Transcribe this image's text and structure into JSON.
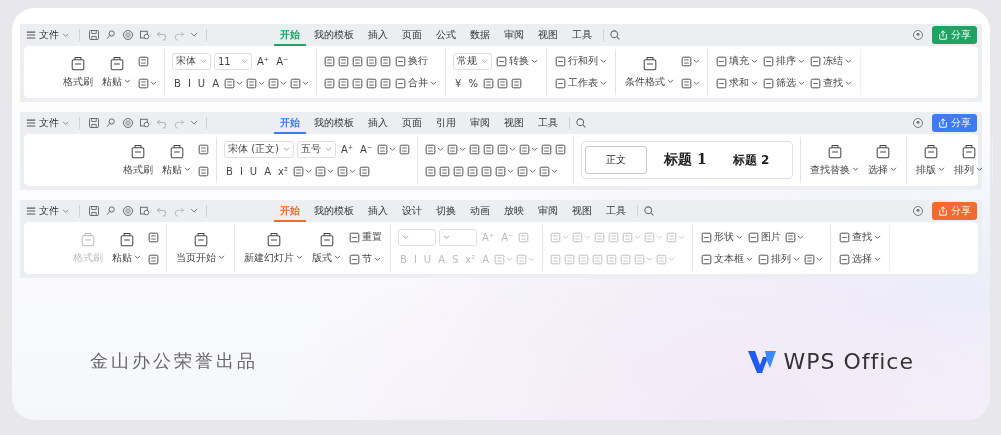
{
  "toolbars": [
    {
      "kind": "spreadsheet",
      "color": "#1ea362",
      "file_menu": "文件",
      "share": "分享",
      "tabs": [
        {
          "label": "开始",
          "selected": true
        },
        {
          "label": "我的模板",
          "selected": false
        },
        {
          "label": "插入",
          "selected": false
        },
        {
          "label": "页面",
          "selected": false
        },
        {
          "label": "公式",
          "selected": false
        },
        {
          "label": "数据",
          "selected": false
        },
        {
          "label": "审阅",
          "selected": false
        },
        {
          "label": "视图",
          "selected": false
        },
        {
          "label": "工具",
          "selected": false
        }
      ],
      "groups": [
        {
          "disabled": false,
          "items": [
            {
              "kind": "large",
              "label": "格式刷",
              "caret": false,
              "disabled": false
            },
            {
              "kind": "large",
              "label": "粘贴",
              "caret": true,
              "disabled": false
            },
            {
              "kind": "stack",
              "top": [
                {
                  "kind": "icon",
                  "caret": false
                }
              ],
              "bottom": [
                {
                  "kind": "icon",
                  "caret": true
                }
              ]
            }
          ]
        },
        {
          "disabled": false,
          "items": [
            {
              "kind": "stack",
              "top": [
                {
                  "kind": "field",
                  "value": "宋体"
                },
                {
                  "kind": "field",
                  "value": "11"
                },
                {
                  "kind": "glyph",
                  "text": "A⁺"
                },
                {
                  "kind": "glyph",
                  "text": "A⁻"
                }
              ],
              "bottom": [
                {
                  "kind": "glyph",
                  "text": "B"
                },
                {
                  "kind": "glyph",
                  "text": "I"
                },
                {
                  "kind": "glyph",
                  "text": "U"
                },
                {
                  "kind": "glyph",
                  "text": "A"
                },
                {
                  "kind": "icon",
                  "caret": true
                },
                {
                  "kind": "icon",
                  "caret": true
                },
                {
                  "kind": "icon",
                  "caret": true
                },
                {
                  "kind": "icon",
                  "caret": true
                }
              ]
            }
          ]
        },
        {
          "disabled": false,
          "items": [
            {
              "kind": "stack",
              "top": [
                {
                  "kind": "icon",
                  "caret": false
                },
                {
                  "kind": "icon",
                  "caret": false
                },
                {
                  "kind": "icon",
                  "caret": false
                },
                {
                  "kind": "icon",
                  "caret": false
                },
                {
                  "kind": "icon",
                  "caret": false
                },
                {
                  "kind": "labeled",
                  "label": "换行",
                  "caret": false
                }
              ],
              "bottom": [
                {
                  "kind": "icon",
                  "caret": false
                },
                {
                  "kind": "icon",
                  "caret": false
                },
                {
                  "kind": "icon",
                  "caret": false
                },
                {
                  "kind": "icon",
                  "caret": false
                },
                {
                  "kind": "icon",
                  "caret": false
                },
                {
                  "kind": "labeled",
                  "label": "合并",
                  "caret": true
                }
              ]
            }
          ]
        },
        {
          "disabled": false,
          "items": [
            {
              "kind": "stack",
              "top": [
                {
                  "kind": "field",
                  "value": "常规"
                },
                {
                  "kind": "labeled",
                  "label": "转换",
                  "caret": true
                }
              ],
              "bottom": [
                {
                  "kind": "glyph",
                  "text": "¥"
                },
                {
                  "kind": "glyph",
                  "text": "%"
                },
                {
                  "kind": "icon",
                  "caret": false
                },
                {
                  "kind": "icon",
                  "caret": false
                },
                {
                  "kind": "icon",
                  "caret": false
                }
              ]
            }
          ]
        },
        {
          "disabled": false,
          "items": [
            {
              "kind": "stack",
              "top": [
                {
                  "kind": "labeled",
                  "label": "行和列",
                  "caret": true
                }
              ],
              "bottom": [
                {
                  "kind": "labeled",
                  "label": "工作表",
                  "caret": true
                }
              ]
            }
          ]
        },
        {
          "disabled": false,
          "items": [
            {
              "kind": "large",
              "label": "条件格式",
              "caret": true,
              "disabled": false
            },
            {
              "kind": "stack",
              "top": [
                {
                  "kind": "icon",
                  "caret": true
                }
              ],
              "bottom": [
                {
                  "kind": "icon",
                  "caret": true
                }
              ]
            }
          ]
        },
        {
          "disabled": false,
          "items": [
            {
              "kind": "stack",
              "top": [
                {
                  "kind": "labeled",
                  "label": "填充",
                  "caret": true
                },
                {
                  "kind": "labeled",
                  "label": "排序",
                  "caret": true
                },
                {
                  "kind": "labeled",
                  "label": "冻结",
                  "caret": true
                }
              ],
              "bottom": [
                {
                  "kind": "labeled",
                  "label": "求和",
                  "caret": true
                },
                {
                  "kind": "labeled",
                  "label": "筛选",
                  "caret": true
                },
                {
                  "kind": "labeled",
                  "label": "查找",
                  "caret": true
                }
              ]
            }
          ]
        }
      ]
    },
    {
      "kind": "document",
      "color": "#3b7cf5",
      "file_menu": "文件",
      "share": "分享",
      "tabs": [
        {
          "label": "开始",
          "selected": true
        },
        {
          "label": "我的模板",
          "selected": false
        },
        {
          "label": "插入",
          "selected": false
        },
        {
          "label": "页面",
          "selected": false
        },
        {
          "label": "引用",
          "selected": false
        },
        {
          "label": "审阅",
          "selected": false
        },
        {
          "label": "视图",
          "selected": false
        },
        {
          "label": "工具",
          "selected": false
        }
      ],
      "groups": [
        {
          "disabled": false,
          "items": [
            {
              "kind": "large",
              "label": "格式刷",
              "caret": false,
              "disabled": false
            },
            {
              "kind": "large",
              "label": "粘贴",
              "caret": true,
              "disabled": false
            },
            {
              "kind": "stack",
              "top": [
                {
                  "kind": "icon",
                  "caret": false
                }
              ],
              "bottom": [
                {
                  "kind": "icon",
                  "caret": false
                }
              ]
            }
          ]
        },
        {
          "disabled": false,
          "items": [
            {
              "kind": "stack",
              "top": [
                {
                  "kind": "field",
                  "value": "宋体 (正文)"
                },
                {
                  "kind": "field",
                  "value": "五号"
                },
                {
                  "kind": "glyph",
                  "text": "A⁺"
                },
                {
                  "kind": "glyph",
                  "text": "A⁻"
                },
                {
                  "kind": "icon",
                  "caret": true
                },
                {
                  "kind": "icon",
                  "caret": false
                }
              ],
              "bottom": [
                {
                  "kind": "glyph",
                  "text": "B"
                },
                {
                  "kind": "glyph",
                  "text": "I"
                },
                {
                  "kind": "glyph",
                  "text": "U"
                },
                {
                  "kind": "glyph",
                  "text": "A"
                },
                {
                  "kind": "glyph",
                  "text": "x²"
                },
                {
                  "kind": "icon",
                  "caret": true
                },
                {
                  "kind": "icon",
                  "caret": true
                },
                {
                  "kind": "icon",
                  "caret": true
                },
                {
                  "kind": "icon",
                  "caret": false
                }
              ]
            }
          ]
        },
        {
          "disabled": false,
          "items": [
            {
              "kind": "stack",
              "top": [
                {
                  "kind": "icon",
                  "caret": true
                },
                {
                  "kind": "icon",
                  "caret": true
                },
                {
                  "kind": "icon",
                  "caret": false
                },
                {
                  "kind": "icon",
                  "caret": false
                },
                {
                  "kind": "icon",
                  "caret": true
                },
                {
                  "kind": "icon",
                  "caret": true
                },
                {
                  "kind": "icon",
                  "caret": false
                },
                {
                  "kind": "icon",
                  "caret": false
                }
              ],
              "bottom": [
                {
                  "kind": "icon",
                  "caret": false
                },
                {
                  "kind": "icon",
                  "caret": false
                },
                {
                  "kind": "icon",
                  "caret": false
                },
                {
                  "kind": "icon",
                  "caret": false
                },
                {
                  "kind": "icon",
                  "caret": false
                },
                {
                  "kind": "icon",
                  "caret": true
                },
                {
                  "kind": "icon",
                  "caret": true
                },
                {
                  "kind": "icon",
                  "caret": true
                }
              ]
            }
          ]
        },
        {
          "disabled": false,
          "items": [
            {
              "kind": "gallery",
              "styles": [
                {
                  "label": "正文",
                  "selected": true
                },
                {
                  "label": "标题 1",
                  "selected": false
                },
                {
                  "label": "标题 2",
                  "selected": false
                }
              ]
            }
          ]
        },
        {
          "disabled": false,
          "items": [
            {
              "kind": "large",
              "label": "查找替换",
              "caret": true,
              "disabled": false
            },
            {
              "kind": "large",
              "label": "选择",
              "caret": true,
              "disabled": false
            }
          ]
        },
        {
          "disabled": false,
          "items": [
            {
              "kind": "large",
              "label": "排版",
              "caret": true,
              "disabled": false
            },
            {
              "kind": "large",
              "label": "排列",
              "caret": true,
              "disabled": false
            }
          ]
        }
      ]
    },
    {
      "kind": "presentation",
      "color": "#f26a2e",
      "file_menu": "文件",
      "share": "分享",
      "tabs": [
        {
          "label": "开始",
          "selected": true
        },
        {
          "label": "我的模板",
          "selected": false
        },
        {
          "label": "插入",
          "selected": false
        },
        {
          "label": "设计",
          "selected": false
        },
        {
          "label": "切换",
          "selected": false
        },
        {
          "label": "动画",
          "selected": false
        },
        {
          "label": "放映",
          "selected": false
        },
        {
          "label": "审阅",
          "selected": false
        },
        {
          "label": "视图",
          "selected": false
        },
        {
          "label": "工具",
          "selected": false
        }
      ],
      "groups": [
        {
          "disabled": false,
          "items": [
            {
              "kind": "large",
              "label": "格式刷",
              "caret": false,
              "disabled": true
            },
            {
              "kind": "large",
              "label": "粘贴",
              "caret": true,
              "disabled": false
            },
            {
              "kind": "stack",
              "top": [
                {
                  "kind": "icon",
                  "caret": false
                }
              ],
              "bottom": [
                {
                  "kind": "icon",
                  "caret": false
                }
              ]
            }
          ]
        },
        {
          "disabled": false,
          "items": [
            {
              "kind": "large",
              "label": "当页开始",
              "caret": true,
              "disabled": false
            }
          ]
        },
        {
          "disabled": false,
          "items": [
            {
              "kind": "large",
              "label": "新建幻灯片",
              "caret": true,
              "disabled": false
            },
            {
              "kind": "large",
              "label": "版式",
              "caret": true,
              "disabled": false
            },
            {
              "kind": "stack",
              "top": [
                {
                  "kind": "labeled",
                  "label": "重置",
                  "caret": false
                }
              ],
              "bottom": [
                {
                  "kind": "labeled",
                  "label": "节",
                  "caret": true
                }
              ]
            }
          ]
        },
        {
          "disabled": true,
          "items": [
            {
              "kind": "stack",
              "top": [
                {
                  "kind": "field"
                },
                {
                  "kind": "field"
                },
                {
                  "kind": "glyph",
                  "text": "A⁺"
                },
                {
                  "kind": "glyph",
                  "text": "A⁻"
                },
                {
                  "kind": "icon",
                  "caret": false
                }
              ],
              "bottom": [
                {
                  "kind": "glyph",
                  "text": "B"
                },
                {
                  "kind": "glyph",
                  "text": "I"
                },
                {
                  "kind": "glyph",
                  "text": "U"
                },
                {
                  "kind": "glyph",
                  "text": "A"
                },
                {
                  "kind": "glyph",
                  "text": "S"
                },
                {
                  "kind": "glyph",
                  "text": "x²"
                },
                {
                  "kind": "glyph",
                  "text": "A"
                },
                {
                  "kind": "icon",
                  "caret": true
                },
                {
                  "kind": "icon",
                  "caret": true
                }
              ]
            }
          ]
        },
        {
          "disabled": true,
          "items": [
            {
              "kind": "stack",
              "top": [
                {
                  "kind": "icon",
                  "caret": true
                },
                {
                  "kind": "icon",
                  "caret": true
                },
                {
                  "kind": "icon",
                  "caret": false
                },
                {
                  "kind": "icon",
                  "caret": false
                },
                {
                  "kind": "icon",
                  "caret": true
                },
                {
                  "kind": "icon",
                  "caret": true
                },
                {
                  "kind": "icon",
                  "caret": true
                }
              ],
              "bottom": [
                {
                  "kind": "icon",
                  "caret": false
                },
                {
                  "kind": "icon",
                  "caret": false
                },
                {
                  "kind": "icon",
                  "caret": false
                },
                {
                  "kind": "icon",
                  "caret": false
                },
                {
                  "kind": "icon",
                  "caret": false
                },
                {
                  "kind": "icon",
                  "caret": false
                },
                {
                  "kind": "icon",
                  "caret": true
                },
                {
                  "kind": "icon",
                  "caret": true
                }
              ]
            }
          ]
        },
        {
          "disabled": false,
          "items": [
            {
              "kind": "stack",
              "top": [
                {
                  "kind": "labeled",
                  "label": "形状",
                  "caret": true
                },
                {
                  "kind": "labeled",
                  "label": "图片",
                  "caret": false
                },
                {
                  "kind": "icon",
                  "caret": true
                }
              ],
              "bottom": [
                {
                  "kind": "labeled",
                  "label": "文本框",
                  "caret": true
                },
                {
                  "kind": "labeled",
                  "label": "排列",
                  "caret": true
                },
                {
                  "kind": "icon",
                  "caret": true
                }
              ]
            }
          ]
        },
        {
          "disabled": false,
          "items": [
            {
              "kind": "stack",
              "top": [
                {
                  "kind": "labeled",
                  "label": "查找",
                  "caret": true
                }
              ],
              "bottom": [
                {
                  "kind": "labeled",
                  "label": "选择",
                  "caret": true
                }
              ]
            }
          ]
        }
      ]
    }
  ],
  "footer": {
    "credit": "金山办公荣誉出品",
    "logo_text": "WPS Office"
  }
}
